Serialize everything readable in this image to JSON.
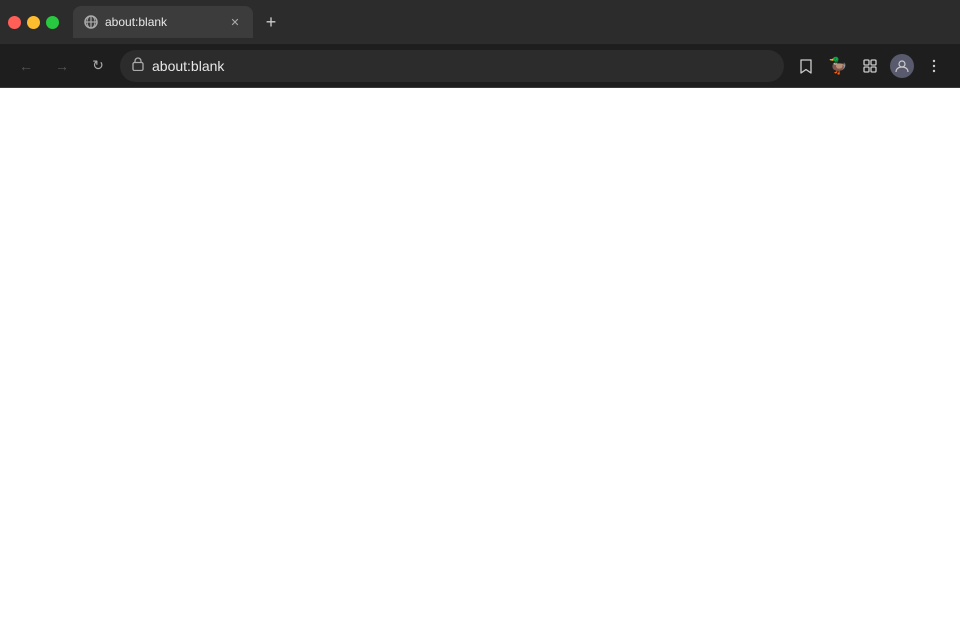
{
  "titlebar": {
    "tab": {
      "title": "about:blank",
      "favicon": "○"
    },
    "new_tab_label": "+"
  },
  "navbar": {
    "back_label": "←",
    "forward_label": "→",
    "reload_label": "↻",
    "address": "about:blank",
    "address_placeholder": "about:blank",
    "bookmark_label": "☆",
    "ext1_label": "🦆",
    "ext2_label": "🧩",
    "profile_label": "👤",
    "menu_label": "⋮"
  },
  "page": {
    "background": "#ffffff"
  }
}
